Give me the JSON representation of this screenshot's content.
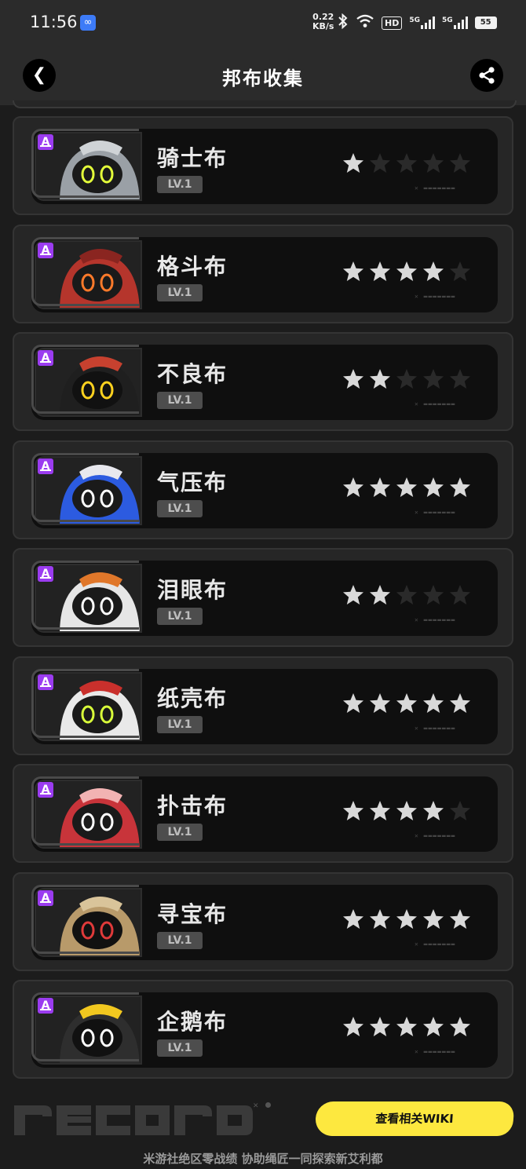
{
  "status_bar": {
    "time": "11:56",
    "net_speed_value": "0.22",
    "net_speed_unit": "KB/s",
    "hd_label": "HD",
    "sig1_label": "5G",
    "sig2_label": "5G",
    "battery": "55",
    "icons": [
      "link-icon",
      "bluetooth-icon",
      "wifi-icon",
      "signal-icon",
      "signal-icon",
      "battery-icon"
    ]
  },
  "header": {
    "title": "邦布收集",
    "back_icon": "chevron-left-icon",
    "share_icon": "share-icon"
  },
  "bangboos": [
    {
      "name": "骑士布",
      "level": "LV.1",
      "rank": "A",
      "stars": 1,
      "body": "#9aa0a6",
      "accent": "#cfd3d6",
      "eye": "#e4ff3a",
      "face": "#1a1a1a"
    },
    {
      "name": "格斗布",
      "level": "LV.1",
      "rank": "A",
      "stars": 4,
      "body": "#b5352c",
      "accent": "#8a2520",
      "eye": "#ff7a2a",
      "face": "#1a1a1a"
    },
    {
      "name": "不良布",
      "level": "LV.1",
      "rank": "A",
      "stars": 2,
      "body": "#1f1f1f",
      "accent": "#c7412f",
      "eye": "#ffd21f",
      "face": "#111111"
    },
    {
      "name": "气压布",
      "level": "LV.1",
      "rank": "A",
      "stars": 5,
      "body": "#2c5be0",
      "accent": "#e8e8ee",
      "eye": "#ffffff",
      "face": "#1a1a1a"
    },
    {
      "name": "泪眼布",
      "level": "LV.1",
      "rank": "A",
      "stars": 2,
      "body": "#e6e6e6",
      "accent": "#e0772a",
      "eye": "#ffffff",
      "face": "#1a1a1a"
    },
    {
      "name": "纸壳布",
      "level": "LV.1",
      "rank": "A",
      "stars": 5,
      "body": "#e9e9e9",
      "accent": "#c9302c",
      "eye": "#d9ff3a",
      "face": "#1a1a1a"
    },
    {
      "name": "扑击布",
      "level": "LV.1",
      "rank": "A",
      "stars": 4,
      "body": "#c8343a",
      "accent": "#f2b3b3",
      "eye": "#ffffff",
      "face": "#1a1a1a"
    },
    {
      "name": "寻宝布",
      "level": "LV.1",
      "rank": "A",
      "stars": 5,
      "body": "#b89a6a",
      "accent": "#d9c49a",
      "eye": "#e03a3a",
      "face": "#111111"
    },
    {
      "name": "企鹅布",
      "level": "LV.1",
      "rank": "A",
      "stars": 5,
      "body": "#2e2e2e",
      "accent": "#f2c81f",
      "eye": "#ffffff",
      "face": "#111111"
    }
  ],
  "max_stars": 5,
  "colors": {
    "star_on": "#d9d9d9",
    "star_off": "#2a2a2a",
    "rank_a": "#9b3cf0",
    "wiki_button": "#fde83f"
  },
  "footer": {
    "logo_text": "record",
    "wiki_button": "查看相关WIKI",
    "tagline": "米游社绝区零战绩 协助绳匠一同探索新艾利都"
  }
}
